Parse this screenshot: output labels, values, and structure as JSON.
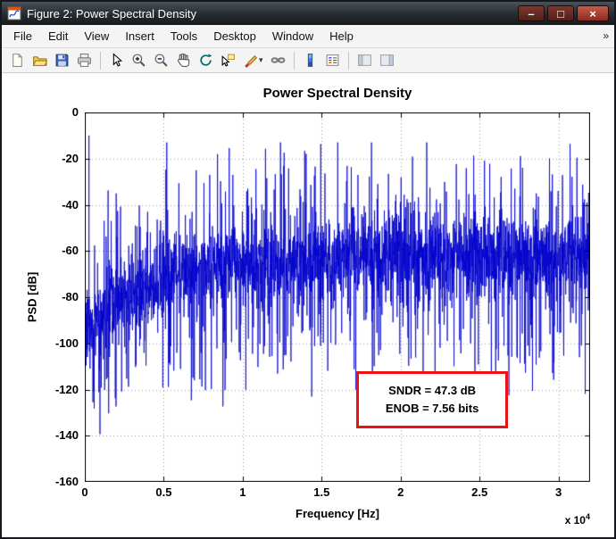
{
  "window": {
    "title": "Figure 2: Power Spectral Density",
    "icon": "matlab-figure",
    "controls": [
      {
        "name": "minimize",
        "glyph": "–"
      },
      {
        "name": "maximize",
        "glyph": "□"
      },
      {
        "name": "close",
        "glyph": "×"
      }
    ]
  },
  "menubar": {
    "items": [
      "File",
      "Edit",
      "View",
      "Insert",
      "Tools",
      "Desktop",
      "Window",
      "Help"
    ],
    "overflow_glyph": "»"
  },
  "toolbar": {
    "dropdown_glyph": "▾",
    "buttons": [
      {
        "name": "new-figure"
      },
      {
        "name": "open-file"
      },
      {
        "name": "save-figure"
      },
      {
        "name": "print-figure"
      },
      {
        "name": "separator"
      },
      {
        "name": "edit-plot"
      },
      {
        "name": "zoom-in"
      },
      {
        "name": "zoom-out"
      },
      {
        "name": "pan"
      },
      {
        "name": "rotate-3d"
      },
      {
        "name": "data-cursor"
      },
      {
        "name": "brush",
        "dropdown": true
      },
      {
        "name": "link-plot"
      },
      {
        "name": "separator"
      },
      {
        "name": "insert-colorbar"
      },
      {
        "name": "insert-legend"
      },
      {
        "name": "separator"
      },
      {
        "name": "hide-plot-tools"
      },
      {
        "name": "show-plot-tools"
      }
    ]
  },
  "chart_data": {
    "type": "line",
    "title": "Power Spectral Density",
    "xlabel": "Frequency [Hz]",
    "ylabel": "PSD [dB]",
    "x_multiplier": {
      "prefix": "x 10",
      "exponent": "4"
    },
    "xlim": [
      0,
      32000
    ],
    "ylim": [
      -160,
      0
    ],
    "xticks": {
      "values": [
        0,
        5000,
        10000,
        15000,
        20000,
        25000,
        30000
      ],
      "labels": [
        "0",
        "0.5",
        "1",
        "1.5",
        "2",
        "2.5",
        "3"
      ]
    },
    "yticks": {
      "values": [
        0,
        -20,
        -40,
        -60,
        -80,
        -100,
        -120,
        -140,
        -160
      ],
      "labels": [
        "0",
        "-20",
        "-40",
        "-60",
        "-80",
        "-100",
        "-120",
        "-140",
        "-160"
      ]
    },
    "grid": true,
    "grid_style": "dotted",
    "line_color": "#0000CC",
    "sndr_db": 47.3,
    "enob_bits": 7.56,
    "annotation": {
      "lines": [
        "SNDR = 47.3 dB",
        "ENOB = 7.56 bits"
      ],
      "border_color": "#EE1111",
      "x_range": [
        17200,
        26800
      ],
      "y_range": [
        -137,
        -112
      ]
    },
    "synthesis": {
      "seed": 1337,
      "n_points": 2800,
      "floor_start_db": -95,
      "floor_end_db": -62,
      "floor_tau_hz": 4000,
      "sigma_db": 9,
      "spike_up_prob": 0.07,
      "spike_up_max_db": 44,
      "spike_down_prob": 0.12,
      "spike_down_max_db": 50,
      "signal_freq_hz": 260,
      "signal_peak_db": -10,
      "clip_top_db": -13,
      "clip_bottom_db": -157
    }
  }
}
